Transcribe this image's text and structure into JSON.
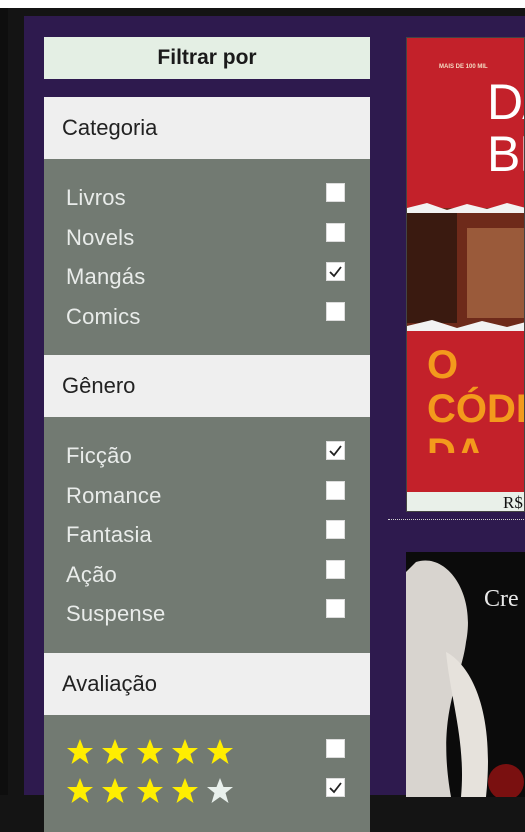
{
  "sidebar": {
    "title": "Filtrar por",
    "sections": [
      {
        "heading": "Categoria",
        "options": [
          {
            "label": "Livros",
            "checked": false
          },
          {
            "label": "Novels",
            "checked": false
          },
          {
            "label": "Mangás",
            "checked": true
          },
          {
            "label": "Comics",
            "checked": false
          }
        ]
      },
      {
        "heading": "Gênero",
        "options": [
          {
            "label": "Ficção",
            "checked": true
          },
          {
            "label": "Romance",
            "checked": false
          },
          {
            "label": "Fantasia",
            "checked": false
          },
          {
            "label": "Ação",
            "checked": false
          },
          {
            "label": "Suspense",
            "checked": false
          }
        ]
      },
      {
        "heading": "Avaliação",
        "ratings": [
          {
            "stars": 5,
            "max": 5,
            "checked": false
          },
          {
            "stars": 4,
            "max": 5,
            "checked": true
          }
        ]
      }
    ]
  },
  "books": [
    {
      "cover_top_text": "MAIS DE 100 MIL",
      "cover_author": "DAN BROWN",
      "cover_title": "O CÓDIGO DA VINCI",
      "price": "R$"
    },
    {
      "cover_title": "Cre"
    }
  ],
  "colors": {
    "frame_bg": "#2e1a4e",
    "section_body": "#727a72",
    "star_filled": "#ffee00",
    "star_empty": "#e8f0ec",
    "book1_cover": "#c02226"
  }
}
